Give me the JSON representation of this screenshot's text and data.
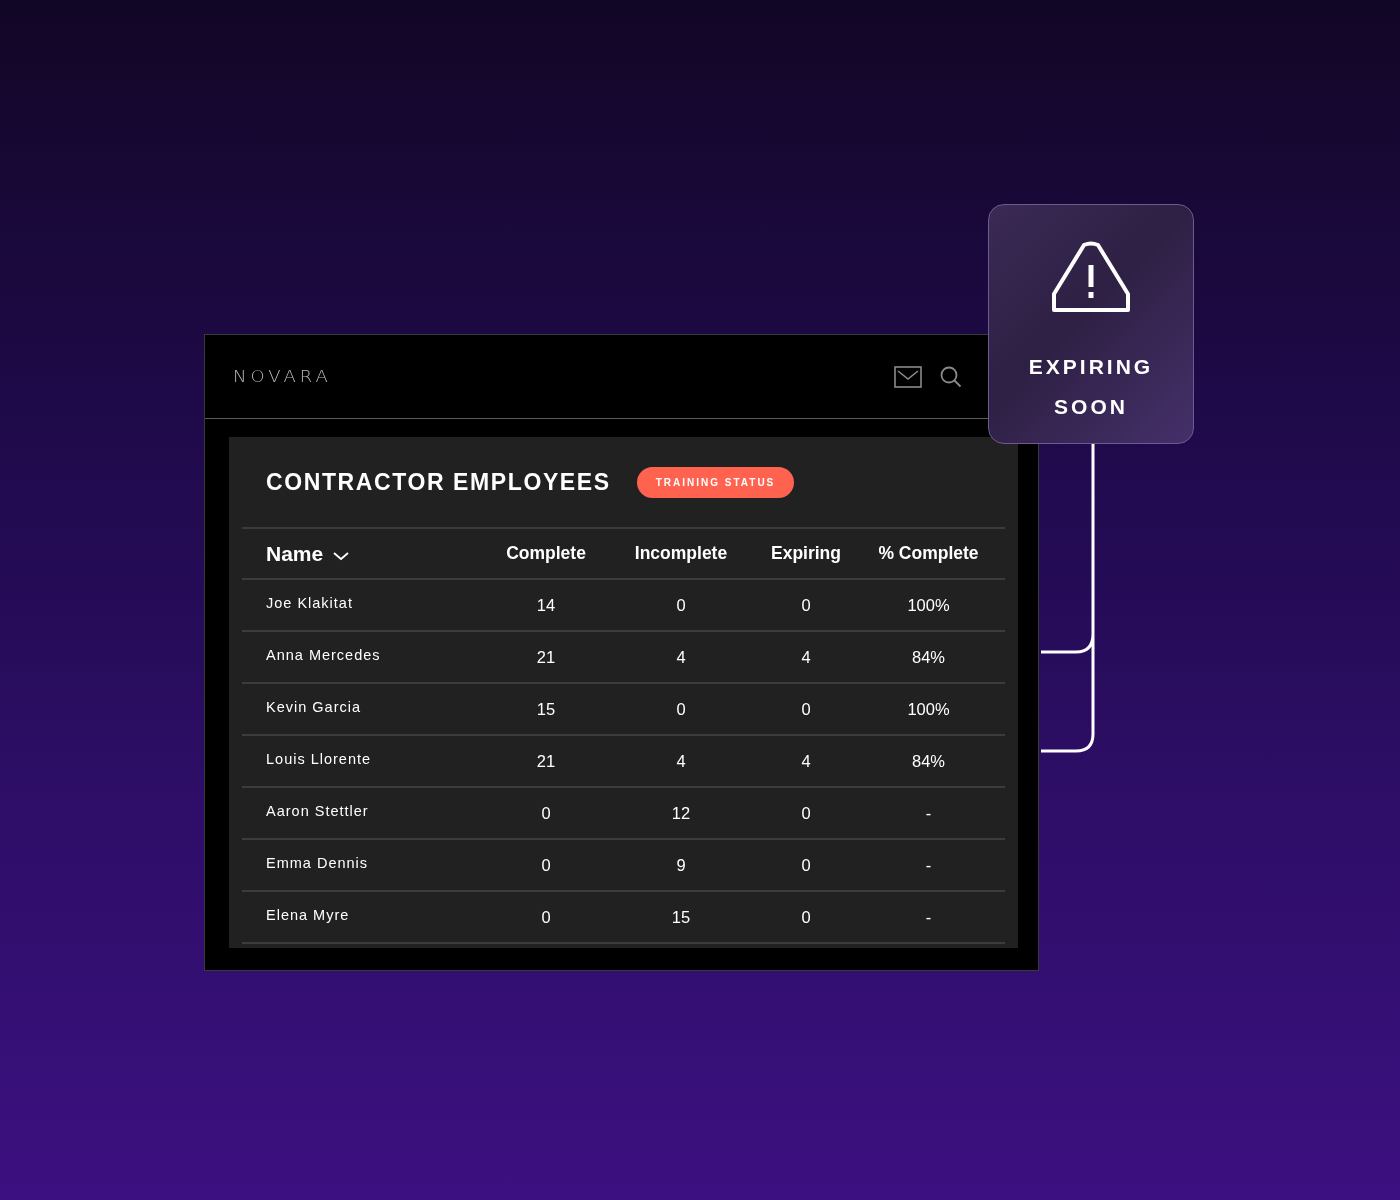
{
  "app": {
    "logo": "NOVARA"
  },
  "panel": {
    "title": "CONTRACTOR EMPLOYEES",
    "badge": "TRAINING STATUS"
  },
  "table": {
    "columns": [
      {
        "label": "Name",
        "sorted": true
      },
      {
        "label": "Complete",
        "sorted": false
      },
      {
        "label": "Incomplete",
        "sorted": false
      },
      {
        "label": "Expiring",
        "sorted": false
      },
      {
        "label": "% Complete",
        "sorted": false
      }
    ],
    "rows": [
      [
        "Joe Klakitat",
        "14",
        "0",
        "0",
        "100%"
      ],
      [
        "Anna Mercedes",
        "21",
        "4",
        "4",
        "84%"
      ],
      [
        "Kevin Garcia",
        "15",
        "0",
        "0",
        "100%"
      ],
      [
        "Louis Llorente",
        "21",
        "4",
        "4",
        "84%"
      ],
      [
        "Aaron Stettler",
        "0",
        "12",
        "0",
        "-"
      ],
      [
        "Emma Dennis",
        "0",
        "9",
        "0",
        "-"
      ],
      [
        "Elena Myre",
        "0",
        "15",
        "0",
        "-"
      ]
    ]
  },
  "callout": {
    "title": "EXPIRING SOON"
  }
}
